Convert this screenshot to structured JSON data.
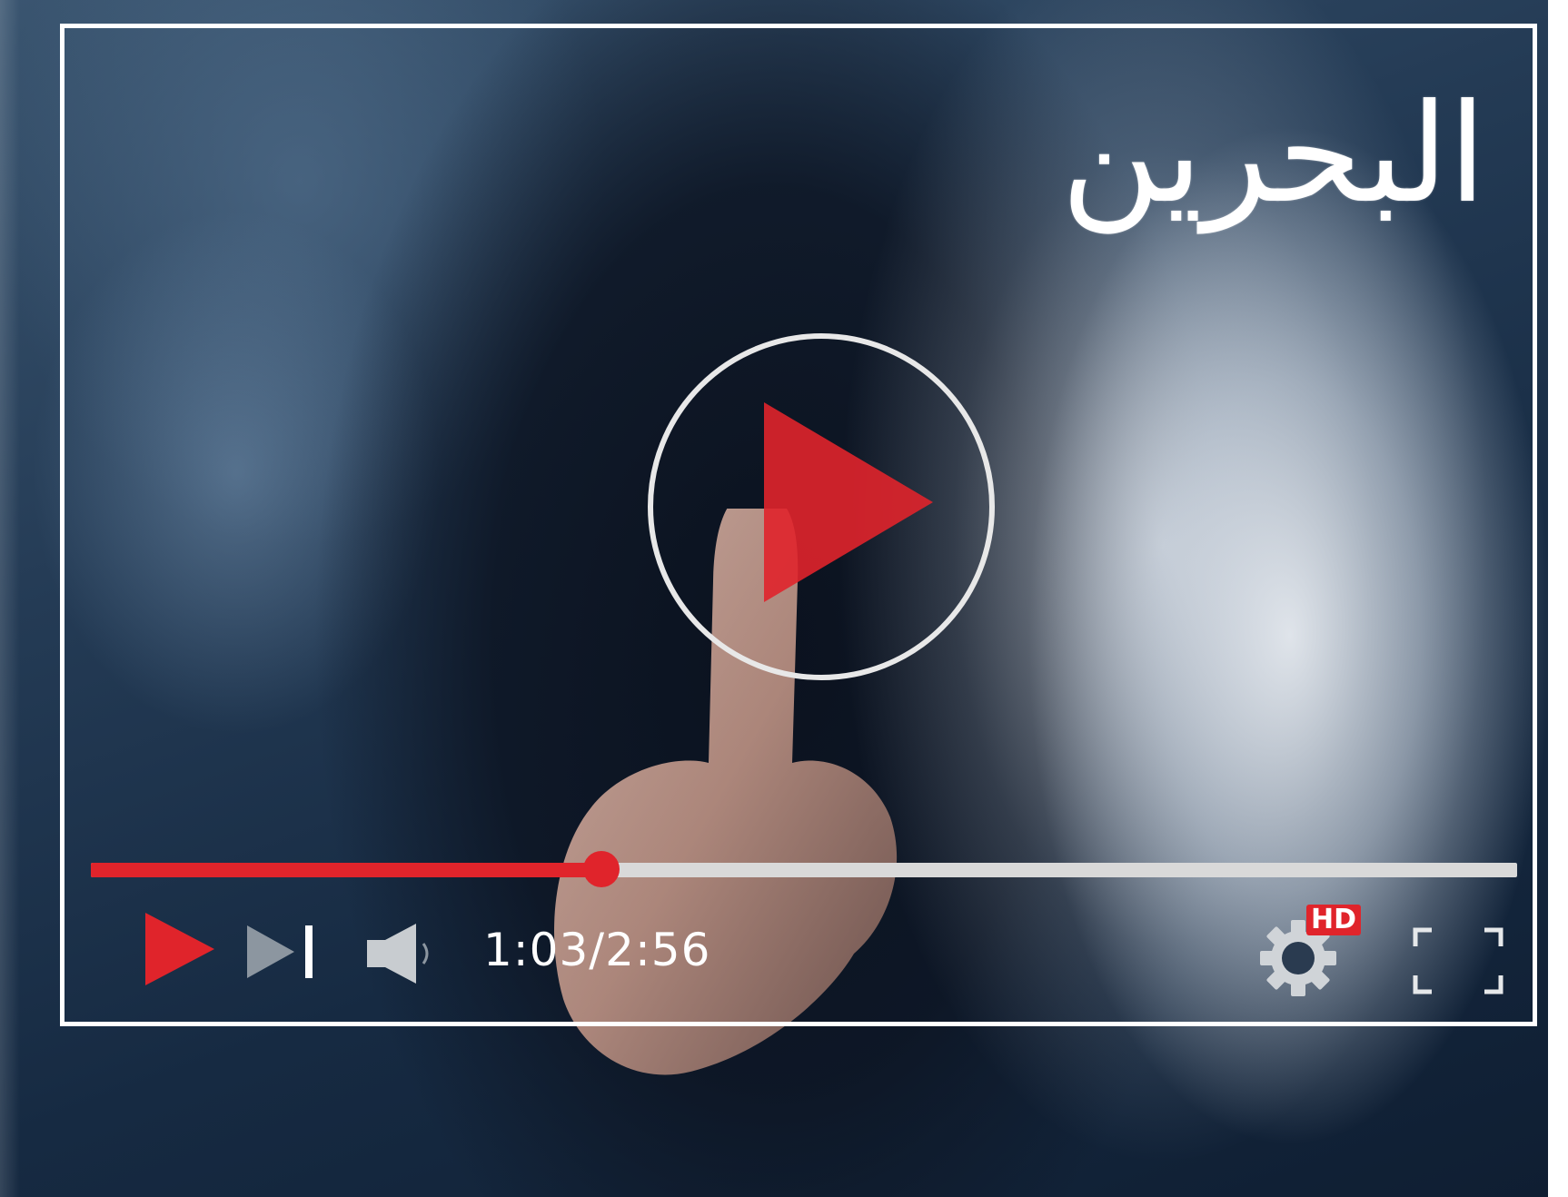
{
  "overlay": {
    "title": "البحرين"
  },
  "player": {
    "time_display": "1:03/2:56",
    "progress_fraction": 0.358,
    "quality_badge": "HD",
    "accent_color": "#e0242b",
    "icons": {
      "big_play": "play-circle-icon",
      "play": "play-icon",
      "next": "skip-next-icon",
      "volume": "volume-icon",
      "settings": "gear-icon",
      "fullscreen": "fullscreen-icon"
    }
  }
}
